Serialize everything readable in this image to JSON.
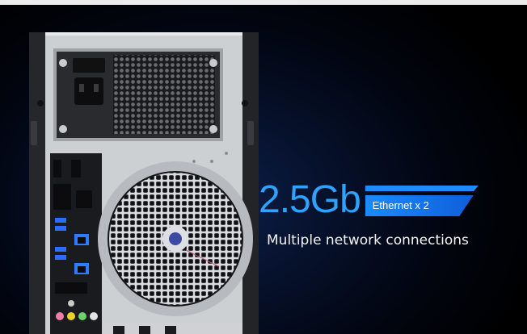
{
  "hero": {
    "speed": "2.5Gb",
    "badge": "Ethernet x 2",
    "subtitle": "Multiple network connections"
  },
  "colors": {
    "accent": "#2ea2ff",
    "badge": "#1a8bff",
    "background": "#010307"
  },
  "product": {
    "icons": [
      "power-socket-icon",
      "cooling-fan-icon",
      "usb-port-icon",
      "ethernet-port-icon",
      "audio-jack-icon"
    ]
  }
}
